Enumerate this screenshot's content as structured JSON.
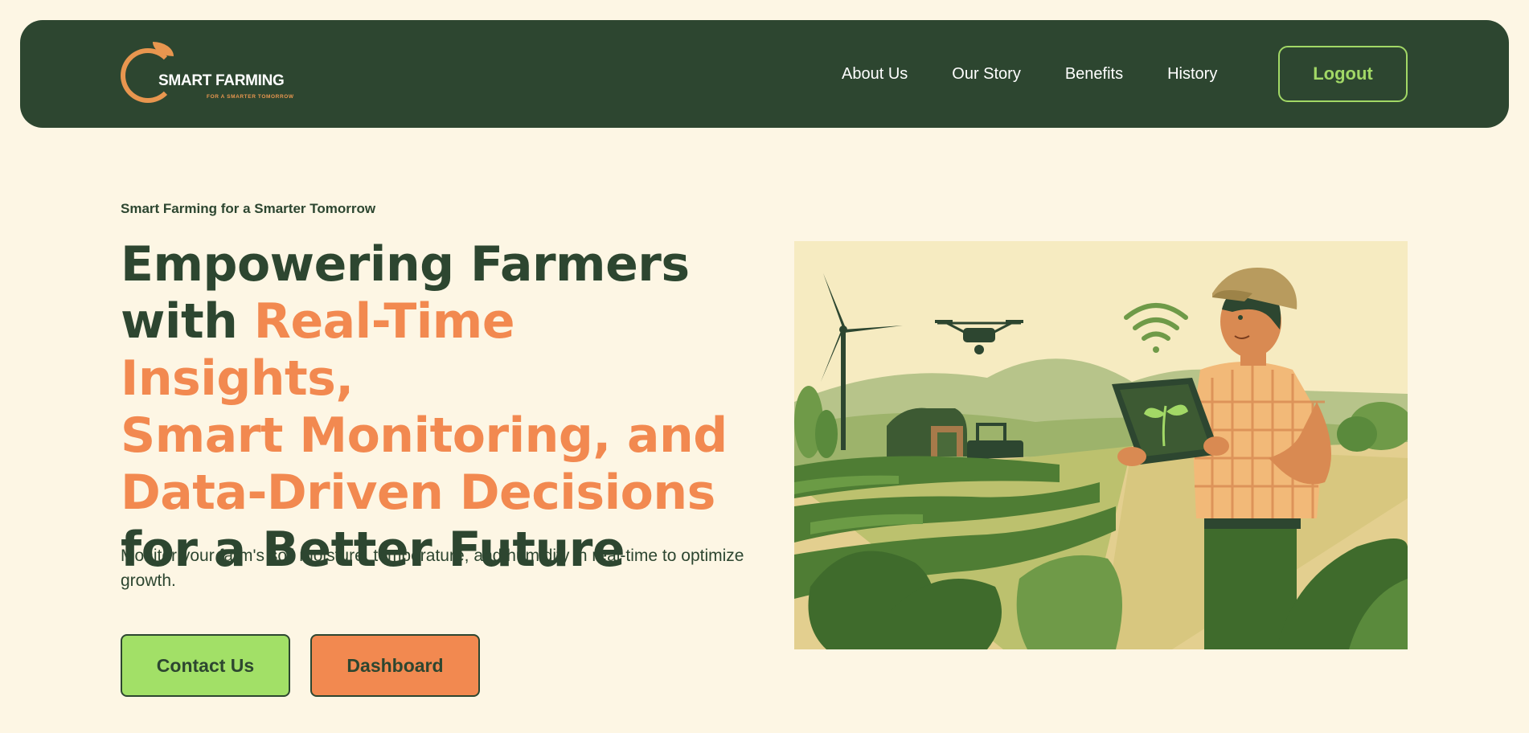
{
  "nav": {
    "logo": {
      "title": "SMART FARMING",
      "tagline": "FOR A SMARTER TOMORROW"
    },
    "links": [
      {
        "label": "About Us"
      },
      {
        "label": "Our Story"
      },
      {
        "label": "Benefits"
      },
      {
        "label": "History"
      }
    ],
    "logout_label": "Logout"
  },
  "hero": {
    "eyebrow": "Smart Farming for a Smarter Tomorrow",
    "headline": {
      "line1": "Empowering Farmers",
      "line2_plain": "with ",
      "line2_accent": "Real-Time Insights,",
      "line3": "Smart Monitoring, and",
      "line4": "Data-Driven Decisions",
      "line5": "for a Better Future"
    },
    "lead": "Monitor your farm's soil moisture, temperature, and humidity in real-time to optimize growth.",
    "buttons": {
      "contact": "Contact Us",
      "dashboard": "Dashboard"
    }
  },
  "colors": {
    "background": "#fdf6e4",
    "nav_green": "#2d4630",
    "accent_orange": "#f28950",
    "accent_lime": "#a2e067"
  }
}
